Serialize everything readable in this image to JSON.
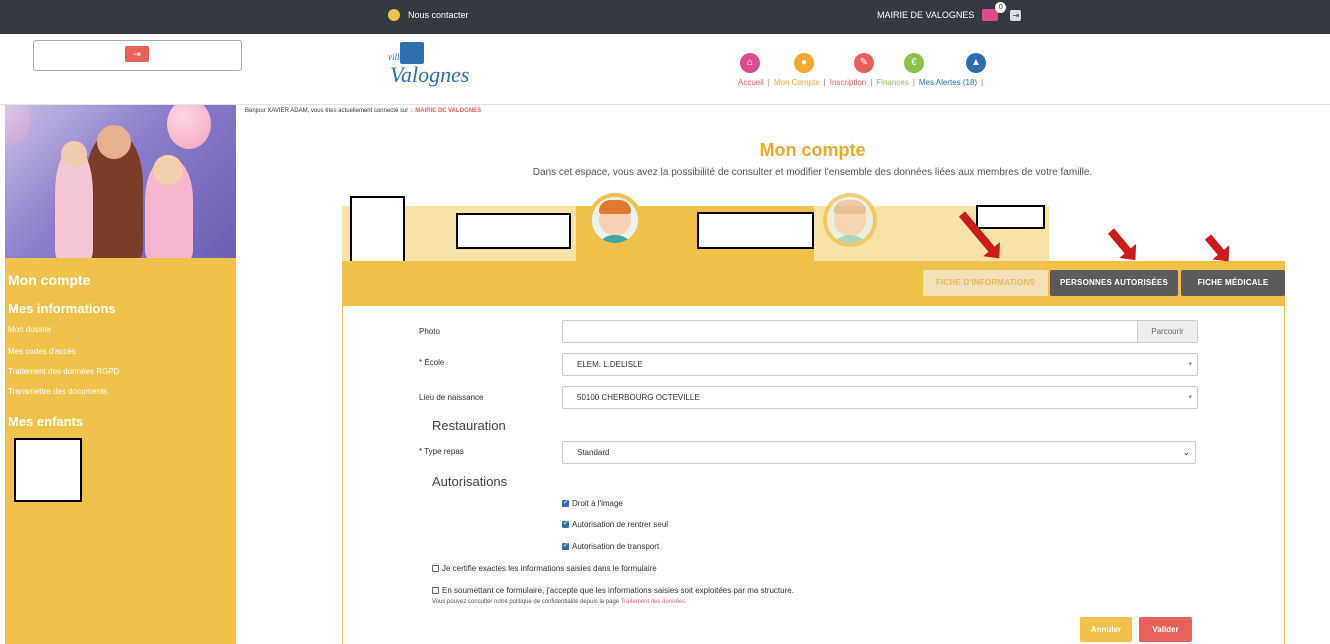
{
  "topbar": {
    "contact_label": "Nous contacter",
    "mairie_label": "MAIRIE DE VALOGNES",
    "messages_count": "0",
    "icons": [
      "chat-icon",
      "envelope-icon",
      "logout-icon"
    ]
  },
  "header": {
    "logo_small": "ville de",
    "logo_word": "Valognes",
    "nav": [
      {
        "label": "Accueil",
        "color": "#e8625b",
        "icon": "home-icon",
        "icon_color": "#d94c8e"
      },
      {
        "label": "Mon Compte",
        "color": "#f0a830",
        "icon": "user-icon",
        "icon_color": "#f0a830"
      },
      {
        "label": "Inscription",
        "color": "#e8625b",
        "icon": "pencil-icon",
        "icon_color": "#e8625b"
      },
      {
        "label": "Finances",
        "color": "#8bc34a",
        "icon": "euro-icon",
        "icon_color": "#8bc34a"
      },
      {
        "label": "Mes Alertes (18)",
        "color": "#2f6fb0",
        "icon": "alert-icon",
        "icon_color": "#2f6fb0"
      }
    ]
  },
  "sidebar": {
    "title": "Mon compte",
    "section1": "Mes informations",
    "links": [
      "Mon dossier",
      "Mes codes d'accès",
      "Traitement des données RGPD",
      "Transmettre des documents"
    ],
    "section2": "Mes enfants"
  },
  "main": {
    "breadcrumb_prefix": "Bonjour XAVIER ADAM, vous êtes actuellement connecté sur",
    "breadcrumb_link": "MAIRIE DE VALOGNES",
    "title": "Mon compte",
    "subtitle": "Dans cet espace, vous avez la possibilité de consulter et modifier l'ensemble des données liées aux membres de votre famille.",
    "tabs": [
      "FICHE D'INFORMATIONS",
      "PERSONNES AUTORISÉES",
      "FICHE MÉDICALE"
    ],
    "active_tab": "FICHE D'INFORMATIONS"
  },
  "form": {
    "photo_label": "Photo",
    "browse_label": "Parcourir",
    "ecole_label": "* École",
    "ecole_value": "ELEM. L.DELISLE",
    "naissance_label": "Lieu de naissance",
    "naissance_value": "50100 CHERBOURG OCTEVILLE",
    "restauration_title": "Restauration",
    "repas_label": "* Type repas",
    "repas_value": "Standard",
    "autorisations_title": "Autorisations",
    "autorisations": [
      {
        "label": "Droit à l'image",
        "checked": true
      },
      {
        "label": "Autorisation de rentrer seul",
        "checked": true
      },
      {
        "label": "Autorisation de transport",
        "checked": true
      }
    ],
    "certify_label": "Je certifie exactes les informations saisies dans le formulaire",
    "consent_label": "En soumettant ce formulaire, j'accepte que les informations saisies soit exploitées par ma structure.",
    "policy_prefix": "Vous pouvez consulter notre politique de confidentialité depuis la page",
    "policy_link": "Traitement des données",
    "cancel_label": "Annuler",
    "submit_label": "Valider"
  },
  "colors": {
    "accent_yellow": "#f0c14b",
    "accent_red": "#e8625b",
    "dark": "#343a40"
  }
}
